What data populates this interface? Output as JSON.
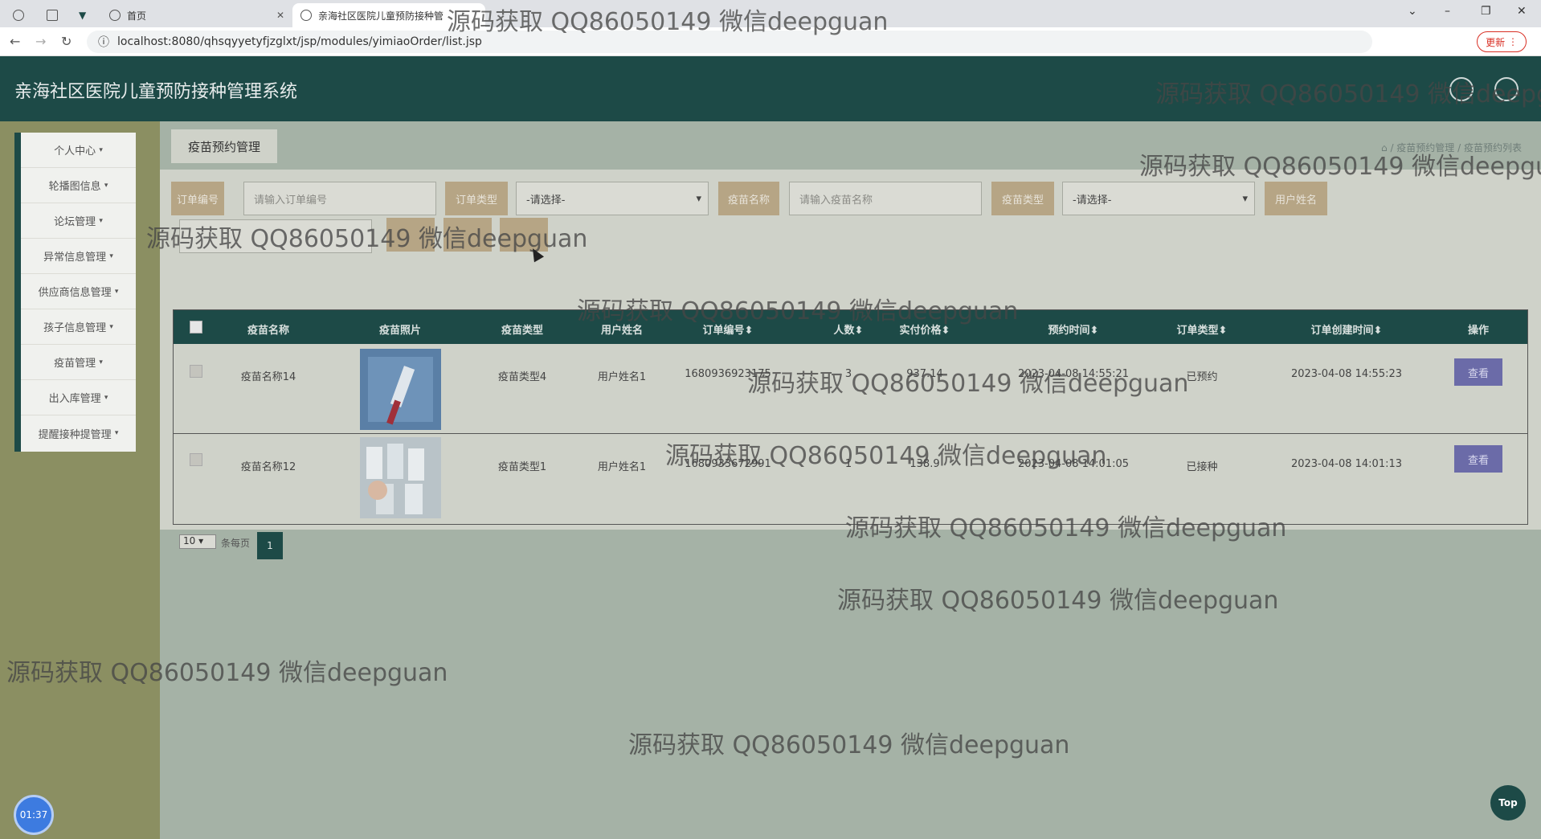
{
  "browser": {
    "tabs": [
      {
        "label": ""
      },
      {
        "label": ""
      },
      {
        "label": "首页"
      },
      {
        "label": "亲海社区医院儿童预防接种管"
      }
    ],
    "url": "localhost:8080/qhsqyyetyfjzglxt/jsp/modules/yimiaoOrder/list.jsp",
    "update_label": "更新"
  },
  "header": {
    "title": "亲海社区医院儿童预防接种管理系统"
  },
  "sidebar": {
    "items": [
      {
        "label": "个人中心"
      },
      {
        "label": "轮播图信息"
      },
      {
        "label": "论坛管理"
      },
      {
        "label": "异常信息管理"
      },
      {
        "label": "供应商信息管理"
      },
      {
        "label": "孩子信息管理"
      },
      {
        "label": "疫苗管理"
      },
      {
        "label": "出入库管理"
      },
      {
        "label": "提醒接种提管理"
      }
    ]
  },
  "page": {
    "section_title": "疫苗预约管理",
    "breadcrumb": [
      "疫苗预约管理",
      "疫苗预约列表"
    ]
  },
  "search": {
    "order_no_label": "订单编号",
    "order_no_placeholder": "请输入订单编号",
    "order_type_label": "订单类型",
    "order_type_value": "-请选择-",
    "vaccine_name_label": "疫苗名称",
    "vaccine_name_placeholder": "请输入疫苗名称",
    "vaccine_type_label": "疫苗类型",
    "vaccine_type_value": "-请选择-",
    "user_name_label": "用户姓名"
  },
  "table": {
    "headers": [
      "疫苗名称",
      "疫苗照片",
      "疫苗类型",
      "用户姓名",
      "订单编号",
      "人数",
      "实付价格",
      "预约时间",
      "订单类型",
      "订单创建时间",
      "操作"
    ],
    "rows": [
      {
        "name": "疫苗名称14",
        "type": "疫苗类型4",
        "user": "用户姓名1",
        "order_no": "1680936923175",
        "count": "3",
        "price": "937.14",
        "appt": "2023-04-08 14:55:21",
        "status": "已预约",
        "created": "2023-04-08 14:55:23",
        "action": "查看"
      },
      {
        "name": "疫苗名称12",
        "type": "疫苗类型1",
        "user": "用户姓名1",
        "order_no": "1680933672991",
        "count": "1",
        "price": "138.9",
        "appt": "2023-04-08 14:01:05",
        "status": "已接种",
        "created": "2023-04-08 14:01:13",
        "action": "查看"
      }
    ]
  },
  "pager": {
    "page_size": "10",
    "per_page_label": "条每页",
    "current_page": "1"
  },
  "watermark": "源码获取 QQ86050149 微信deepguan",
  "timer": "01:37",
  "top_label": "Top"
}
